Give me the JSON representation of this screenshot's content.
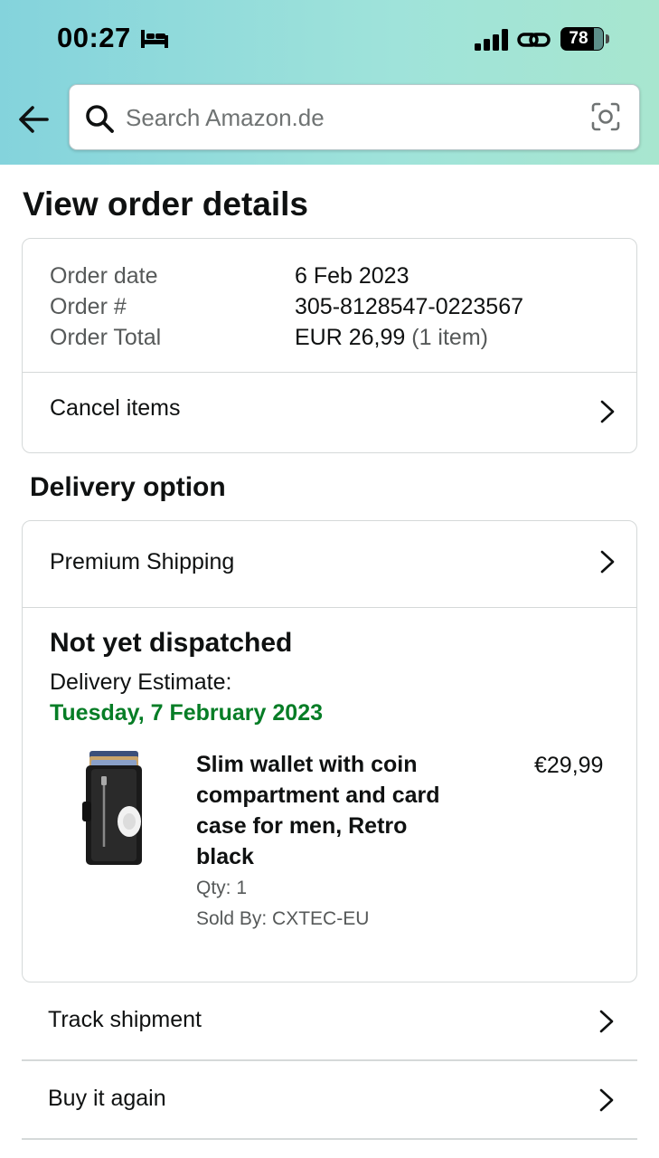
{
  "status_bar": {
    "time": "00:27",
    "battery_level": "78"
  },
  "search": {
    "placeholder": "Search Amazon.de"
  },
  "page": {
    "title": "View order details"
  },
  "order": {
    "date_label": "Order date",
    "date_value": "6 Feb 2023",
    "number_label": "Order #",
    "number_value": "305-8128547-0223567",
    "total_label": "Order Total",
    "total_value": "EUR 26,99",
    "total_items": "(1 item)",
    "cancel_label": "Cancel items"
  },
  "delivery": {
    "section_title": "Delivery option",
    "shipping_option": "Premium Shipping",
    "status": "Not yet dispatched",
    "estimate_label": "Delivery Estimate:",
    "estimate_date": "Tuesday, 7 February 2023",
    "estimate_color": "#067D26"
  },
  "product": {
    "title": "Slim wallet with coin compartment and card case for men, Retro black",
    "price": "€29,99",
    "qty": "Qty: 1",
    "seller": "Sold By: CXTEC-EU"
  },
  "actions": {
    "track_label": "Track shipment",
    "buy_again_label": "Buy it again"
  }
}
